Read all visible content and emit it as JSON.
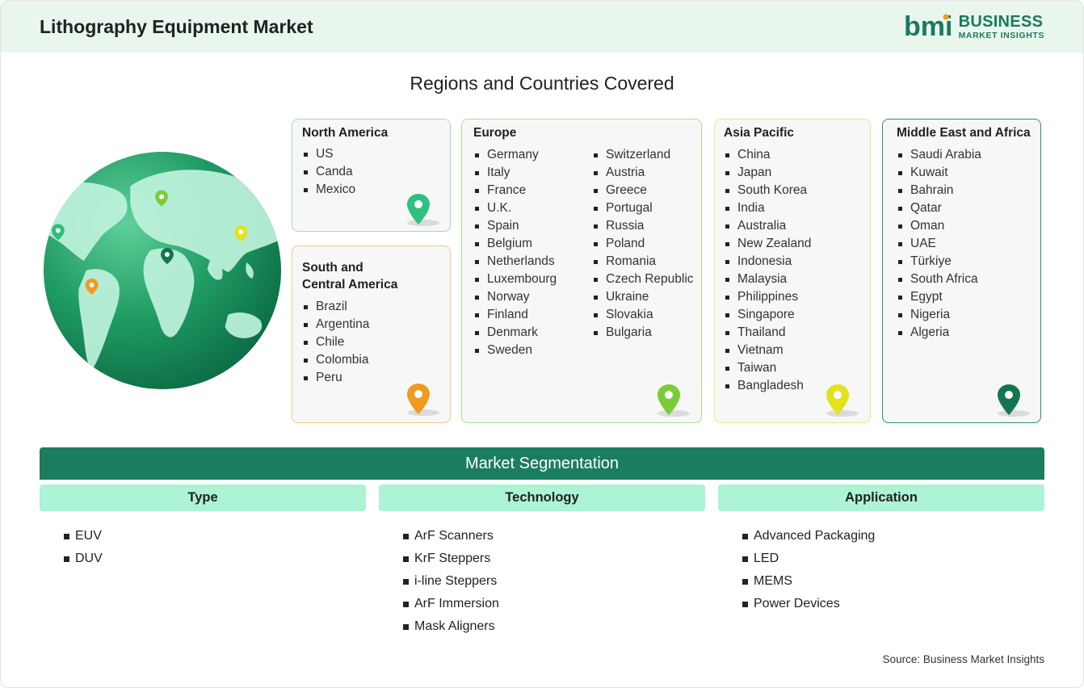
{
  "header": {
    "title": "Lithography Equipment Market",
    "logo_line1": "BUSINESS",
    "logo_line2": "MARKET INSIGHTS",
    "logo_mark": "bmi"
  },
  "regions_title": "Regions and Countries Covered",
  "regions": {
    "north_america": {
      "title": "North America",
      "items": [
        "US",
        "Canda",
        "Mexico"
      ],
      "pin_color": "#2fbf7f"
    },
    "south_central_america": {
      "title_line1": "South and",
      "title_line2": "Central America",
      "items": [
        "Brazil",
        "Argentina",
        "Chile",
        "Colombia",
        "Peru"
      ],
      "pin_color": "#f29a1f"
    },
    "europe": {
      "title": "Europe",
      "col1": [
        "Germany",
        "Italy",
        "France",
        "U.K.",
        "Spain",
        "Belgium",
        "Netherlands",
        "Luxembourg",
        "Norway",
        "Finland",
        "Denmark",
        "Sweden"
      ],
      "col2": [
        "Switzerland",
        "Austria",
        "Greece",
        "Portugal",
        "Russia",
        "Poland",
        "Romania",
        "Czech Republic",
        "Ukraine",
        "Slovakia",
        "Bulgaria"
      ],
      "pin_color": "#7ccc3a"
    },
    "asia_pacific": {
      "title": "Asia Pacific",
      "items": [
        "China",
        "Japan",
        "South Korea",
        "India",
        "Australia",
        "New Zealand",
        "Indonesia",
        "Malaysia",
        "Philippines",
        "Singapore",
        "Thailand",
        "Vietnam",
        "Taiwan",
        "Bangladesh"
      ],
      "pin_color": "#e2e21e"
    },
    "middle_east_africa": {
      "title": "Middle East and Africa",
      "items": [
        "Saudi Arabia",
        "Kuwait",
        "Bahrain",
        "Qatar",
        "Oman",
        "UAE",
        "Türkiye",
        "South Africa",
        "Egypt",
        "Nigeria",
        "Algeria"
      ],
      "pin_color": "#13764f"
    }
  },
  "segmentation": {
    "title": "Market Segmentation",
    "columns": [
      {
        "heading": "Type",
        "items": [
          "EUV",
          "DUV"
        ]
      },
      {
        "heading": "Technology",
        "items": [
          "ArF Scanners",
          "KrF Steppers",
          "i-line Steppers",
          "ArF Immersion",
          "Mask Aligners"
        ]
      },
      {
        "heading": "Application",
        "items": [
          "Advanced Packaging",
          "LED",
          "MEMS",
          "Power Devices"
        ]
      }
    ]
  },
  "source": "Source: Business Market Insights",
  "colors": {
    "brand": "#1a7a5c",
    "segment_banner": "#1b7d5f",
    "segment_head": "#adf3d6",
    "header_bg": "#e8f6ee"
  }
}
